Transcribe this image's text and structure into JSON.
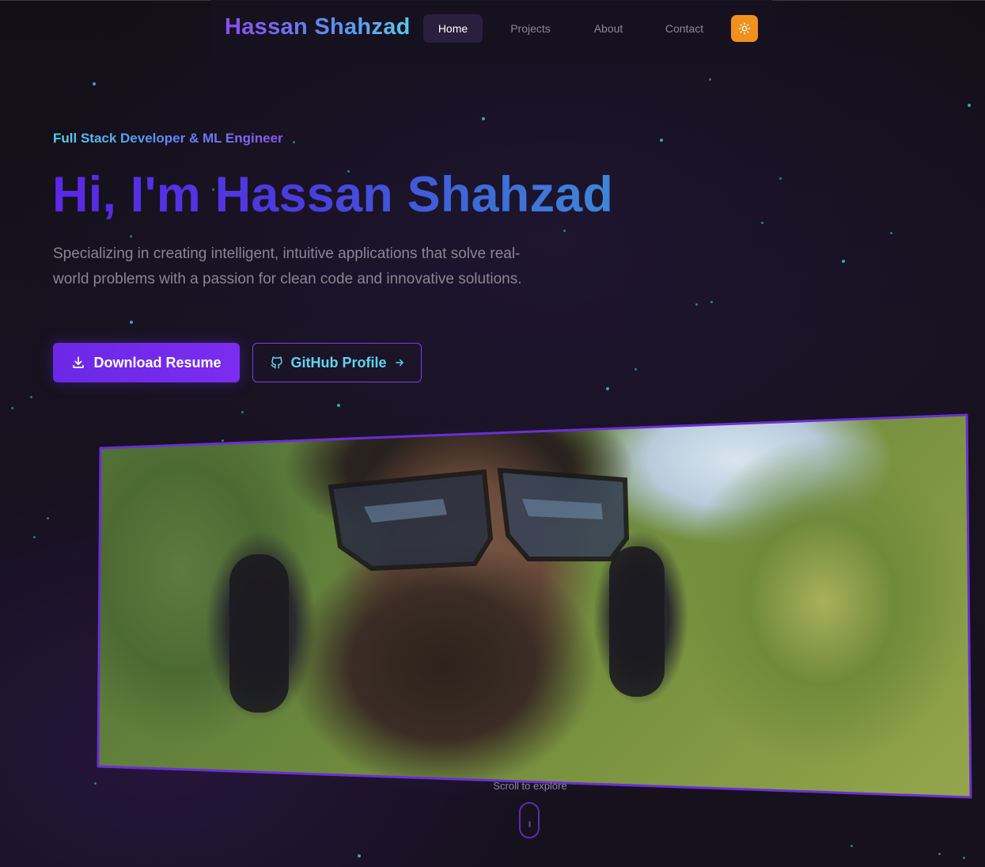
{
  "nav": {
    "brand": "Hassan Shahzad",
    "links": [
      {
        "label": "Home",
        "active": true
      },
      {
        "label": "Projects",
        "active": false
      },
      {
        "label": "About",
        "active": false
      },
      {
        "label": "Contact",
        "active": false
      }
    ],
    "theme_toggle_icon": "sun-icon"
  },
  "hero": {
    "tagline": "Full Stack Developer & ML Engineer",
    "headline": "Hi, I'm Hassan Shahzad",
    "description": "Specializing in creating intelligent, intuitive applications that solve real-world problems with a passion for clean code and innovative solutions.",
    "primary_button": {
      "label": "Download Resume",
      "icon": "download-icon"
    },
    "secondary_button": {
      "label": "GitHub Profile",
      "icon": "github-icon",
      "trailing_icon": "arrow-right-icon"
    }
  },
  "photo": {
    "alt": "Portrait photo"
  },
  "scroll_hint": "Scroll to explore",
  "colors": {
    "background": "#141019",
    "accent_purple": "#7a2cf0",
    "accent_cyan": "#5fd4ee",
    "theme_button": "#f0901f"
  }
}
